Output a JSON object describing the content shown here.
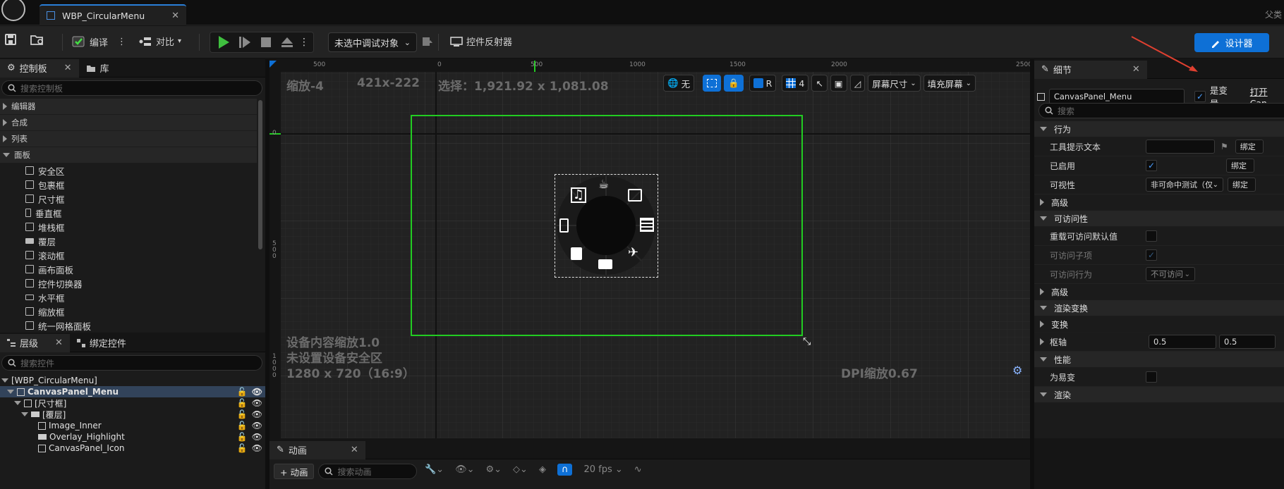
{
  "title_bar": {
    "tab_title": "WBP_CircularMenu",
    "right_text": "父类"
  },
  "toolbar": {
    "compile": "编译",
    "diff": "对比",
    "debug_target": "未选中调试对象",
    "widget_reflector": "控件反射器",
    "designer": "设计器"
  },
  "palette": {
    "tab": "控制板",
    "library_tab": "库",
    "search_placeholder": "搜索控制板",
    "categories": [
      {
        "label": "编辑器"
      },
      {
        "label": "合成"
      },
      {
        "label": "列表"
      },
      {
        "label": "面板"
      }
    ],
    "items": [
      {
        "label": "安全区"
      },
      {
        "label": "包裹框"
      },
      {
        "label": "尺寸框"
      },
      {
        "label": "垂直框"
      },
      {
        "label": "堆栈框"
      },
      {
        "label": "覆层"
      },
      {
        "label": "滚动框"
      },
      {
        "label": "画布面板"
      },
      {
        "label": "控件切换器"
      },
      {
        "label": "水平框"
      },
      {
        "label": "缩放框"
      },
      {
        "label": "统一网格面板"
      }
    ]
  },
  "hierarchy": {
    "tab": "层级",
    "bind_tab": "绑定控件",
    "search_placeholder": "搜索控件",
    "rows": [
      {
        "label": "[WBP_CircularMenu]"
      },
      {
        "label": "CanvasPanel_Menu"
      },
      {
        "label": "[尺寸框]"
      },
      {
        "label": "[覆层]"
      },
      {
        "label": "Image_Inner"
      },
      {
        "label": "Overlay_Highlight"
      },
      {
        "label": "CanvasPanel_Icon"
      }
    ]
  },
  "viewport": {
    "zoom": "缩放-4",
    "size": "421x-222",
    "selection": "选择：1,921.92 x 1,081.08",
    "none_label": "无",
    "r_label": "R",
    "grid_num": "4",
    "screen_size": "屏幕尺寸",
    "fill_screen": "填充屏幕",
    "device_scale": "设备内容缩放1.0",
    "safe_zone": "未设置设备安全区",
    "resolution": "1280 x 720（16:9）",
    "dpi_scale": "DPI缩放0.67",
    "ruler_top": [
      "500",
      "0",
      "500",
      "1000",
      "1500",
      "2000",
      "2500"
    ],
    "ruler_left": [
      "0",
      "5\n0\n0",
      "1\n0\n0\n0"
    ]
  },
  "details": {
    "tab": "细节",
    "widget_name": "CanvasPanel_Menu",
    "is_variable": "是变量",
    "open_link": "打开Can",
    "search_placeholder": "搜索",
    "bind_label": "绑定",
    "sections": {
      "behavior": "行为",
      "advanced1": "高级",
      "accessibility": "可访问性",
      "advanced2": "高级",
      "render_transform": "渲染变换",
      "transform": "变换",
      "pivot": "枢轴",
      "performance": "性能",
      "rendering": "渲染"
    },
    "props": {
      "tooltip": "工具提示文本",
      "enabled": "已启用",
      "visibility": "可视性",
      "visibility_value": "非可命中测试（仅",
      "override_access": "重载可访问默认值",
      "access_children": "可访问子项",
      "access_behavior": "可访问行为",
      "access_behavior_value": "不可访问",
      "pivot_x": "0.5",
      "pivot_y": "0.5",
      "volatile": "为易变"
    }
  },
  "animation": {
    "tab": "动画",
    "add_button": "+ 动画",
    "search_placeholder": "搜索动画",
    "fps": "20 fps"
  },
  "colors": {
    "accent_blue": "#0e70d6",
    "selection_green": "#22cc22",
    "play_green": "#3fbf3f"
  }
}
